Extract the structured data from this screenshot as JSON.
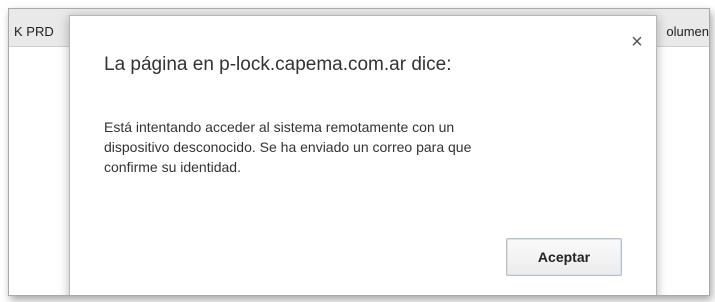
{
  "page": {
    "header_left_text": "K PRD",
    "header_right_text": "olumen"
  },
  "dialog": {
    "title": "La página en p-lock.capema.com.ar dice:",
    "close_glyph": "×",
    "message_lines": [
      "Está intentando acceder al sistema remotamente con un",
      "dispositivo desconocido. Se ha enviado un correo para que",
      "confirme su identidad."
    ],
    "accept_label": "Aceptar"
  },
  "colors": {
    "header_bg": "#e9e9e9",
    "dialog_bg": "#ffffff",
    "text": "#333333"
  }
}
